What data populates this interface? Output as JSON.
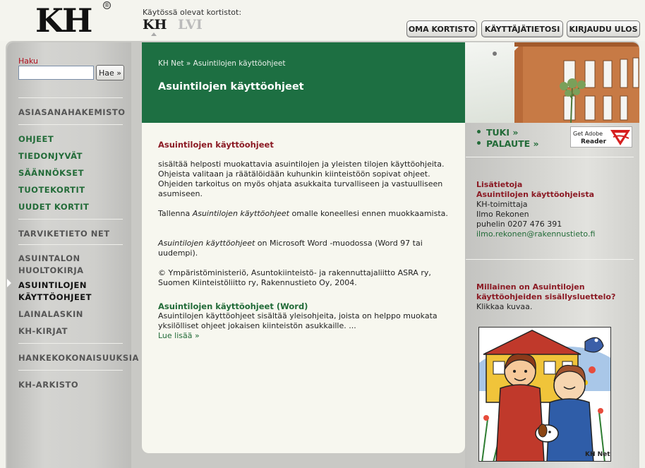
{
  "brand": {
    "logo": "KH",
    "registered": "®"
  },
  "collections": {
    "label": "Käytössä olevat kortistot:",
    "items": [
      "KH",
      "LVI"
    ]
  },
  "top_buttons": {
    "oma": "OMA KORTISTO",
    "kayttaja": "KÄYTTÄJÄTIETOSI",
    "kirjaudu": "KIRJAUDU ULOS"
  },
  "search": {
    "label": "Haku",
    "value": "",
    "button": "Hae »"
  },
  "nav": {
    "asiasana": "ASIASANAHAKEMISTO",
    "ohjeet": "OHJEET",
    "tiedonjyvat": "TIEDONJYVÄT",
    "saannokset": "SÄÄNNÖKSET",
    "tuotekortit": "TUOTEKORTIT",
    "uudet": "UUDET KORTIT",
    "tarviketieto": "TARVIKETIETO NET",
    "huoltokirja_1": "ASUINTALON",
    "huoltokirja_2": "HUOLTOKIRJA",
    "kaytto_1": "ASUINTILOJEN",
    "kaytto_2": "KÄYTTÖOHJEET",
    "lainalaskin": "LAINALASKIN",
    "kh_kirjat": "KH-KIRJAT",
    "hanke": "HANKEKOKONAISUUKSIA",
    "arkisto": "KH-ARKISTO"
  },
  "header": {
    "breadcrumb": "KH Net » Asuintilojen käyttöohjeet",
    "title": "Asuintilojen käyttöohjeet"
  },
  "main": {
    "section_title": "Asuintilojen käyttöohjeet",
    "p1": "sisältää helposti muokattavia asuintilojen ja yleisten tilojen käyttöohjeita. Ohjeista valitaan ja räätälöidään kuhunkin kiinteistöön sopivat ohjeet. Ohjeiden tarkoitus on myös ohjata asukkaita turvalliseen ja vastuulliseen asumiseen.",
    "p2_a": "Tallenna ",
    "p2_em": "Asuintilojen käyttöohjeet",
    "p2_b": " omalle koneellesi ennen muokkaamista.",
    "p3_em": "Asuintilojen käyttöohjeet",
    "p3_b": " on Microsoft Word -muodossa (Word 97 tai uudempi).",
    "p4": "© Ympäristöministeriö, Asuntokiinteistö- ja rakennuttajaliitto ASRA ry, Suomen Kiinteistöliitto ry, Rakennustieto Oy, 2004.",
    "word_title": "Asuintilojen käyttöohjeet (Word)",
    "word_desc": "Asuintilojen käyttöohjeet sisältää yleisohjeita, joista on helppo muokata yksilölliset ohjeet jokaisen kiinteistön asukkaille. ...",
    "read_more": "Lue lisää »"
  },
  "right": {
    "tuki": "TUKI »",
    "palaute": "PALAUTE »",
    "adobe_get": "Get Adobe",
    "adobe_reader": "Reader",
    "info_title_1": "Lisätietoja",
    "info_title_2": "Asuintilojen käyttöohjeista",
    "org": "KH-toimittaja",
    "person": "Ilmo Rekonen",
    "phone": "puhelin 0207 476 391",
    "email": "ilmo.rekonen@rakennustieto.fi",
    "q_1": "Millainen on Asuintilojen",
    "q_2": "käyttöohjeiden sisällysluettelo?",
    "click": "Klikkaa kuvaa.",
    "cover_mark": "KH Net"
  },
  "colors": {
    "header_green": "#1d6f42",
    "link_green": "#226b38",
    "accent_red": "#8b1a24"
  }
}
